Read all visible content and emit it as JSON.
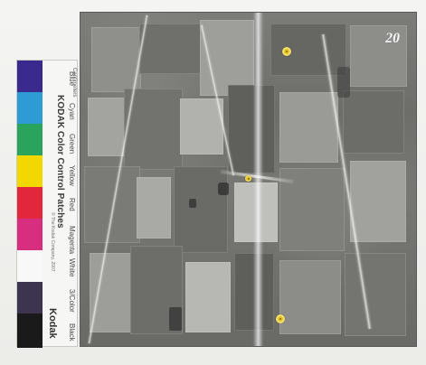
{
  "kodak_strip": {
    "top_text": "Centimeters",
    "title": "KODAK Color Control Patches",
    "subtitle": "© The Kodak Company, 2007",
    "logo": "Kodak",
    "patch_labels": [
      "Blue",
      "Cyan",
      "Green",
      "Yellow",
      "Red",
      "Magenta",
      "White",
      "3/Color",
      "Black"
    ],
    "swatch_colors": [
      "#3a2a8e",
      "#2f9bd5",
      "#2aa35c",
      "#f3d700",
      "#e2263b",
      "#d72e7f",
      "#f8f8f8",
      "#3d354f",
      "#1a1a1a"
    ]
  },
  "photo": {
    "number_label": "20",
    "markers": [
      "marker",
      "marker",
      "marker"
    ]
  }
}
